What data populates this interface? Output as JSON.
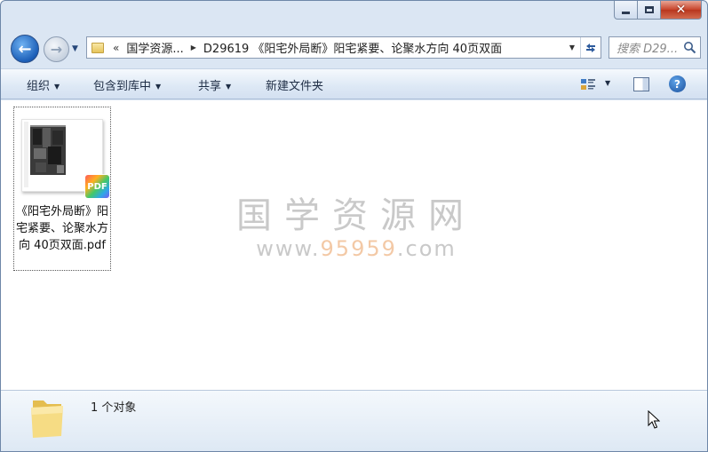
{
  "window": {
    "caption_buttons": {
      "minimize_icon": "minimize-icon",
      "maximize_icon": "maximize-icon",
      "close_icon": "close-icon"
    }
  },
  "nav": {
    "back_icon": "back-arrow-icon",
    "forward_icon": "forward-arrow-icon",
    "breadcrumb_overflow": "«",
    "breadcrumb": [
      "国学资源...",
      "D29619 《阳宅外局断》阳宅紧要、论聚水方向 40页双面"
    ],
    "search_placeholder": "搜索 D29...",
    "refresh_icon": "refresh-icon"
  },
  "toolbar": {
    "organize": "组织",
    "include_in_library": "包含到库中",
    "share": "共享",
    "new_folder": "新建文件夹"
  },
  "files": [
    {
      "name": "《阳宅外局断》阳宅紧要、论聚水方向 40页双面.pdf",
      "badge": "PDF"
    }
  ],
  "watermark": {
    "title": "国学资源网",
    "url_prefix": "www.",
    "url_highlight": "95959",
    "url_suffix": ".com"
  },
  "status": {
    "item_count": "1 个对象"
  },
  "colors": {
    "window_frame": "#dbe6f3",
    "toolbar_text": "#1e2d45",
    "watermark": "#c9c9c9",
    "watermark_accent": "#f3c9a6"
  }
}
